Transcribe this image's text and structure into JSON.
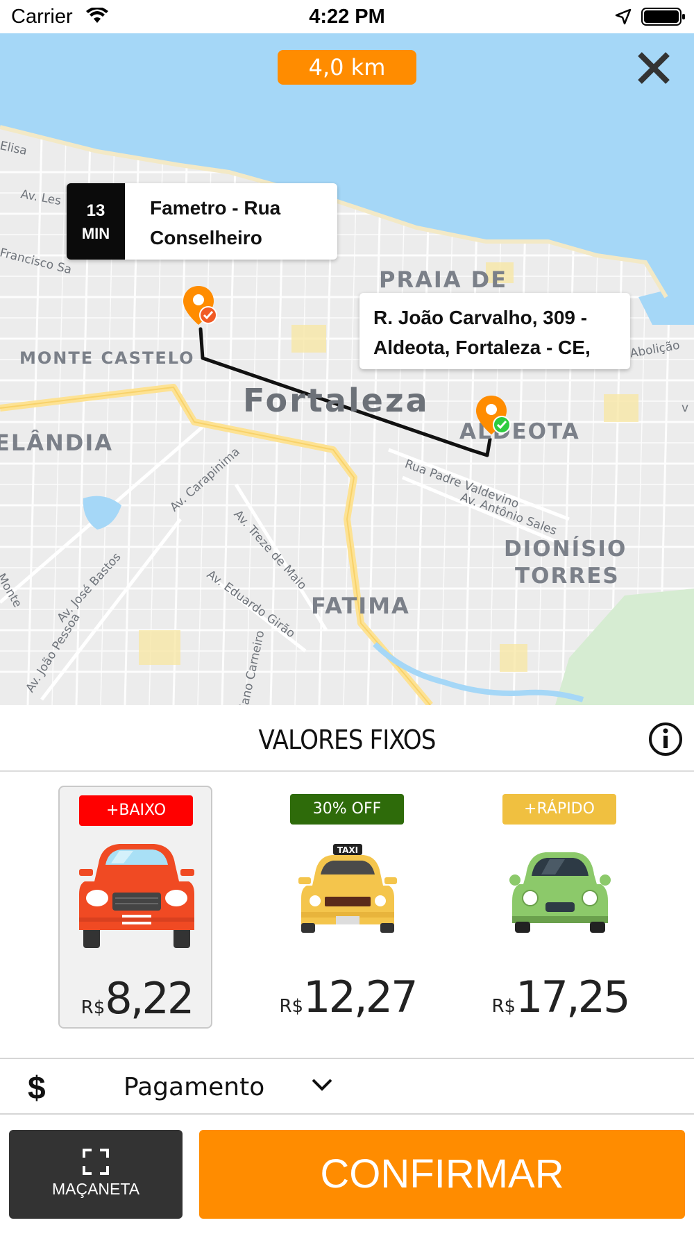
{
  "status_bar": {
    "carrier": "Carrier",
    "time": "4:22 PM",
    "icons": [
      "wifi-icon",
      "location-arrow-icon",
      "battery-icon"
    ]
  },
  "map": {
    "distance": "4,0 km",
    "origin": {
      "eta_value": "13",
      "eta_unit": "MIN",
      "address": "Fametro - Rua Conselheiro"
    },
    "destination": {
      "address": "R. João Carvalho, 309 - Aldeota, Fortaleza - CE,"
    },
    "labels": {
      "city": "Fortaleza",
      "praia": "PRAIA DE",
      "monte_castelo": "MONTE CASTELO",
      "aldeota": "ALDEOTA",
      "elandia": "ELÂNDIA",
      "dionisio": "DIONÍSIO",
      "torres": "TORRES",
      "fatima": "FATIMA"
    },
    "streets": {
      "av_les": "Av. Les",
      "francisco": "Francisco Sa",
      "elisa": "Elisa",
      "abolicao": "Abolição",
      "v": "v",
      "padre": "Rua Padre Valdevino",
      "antonio": "Av. Antônio Sales",
      "carapinima": "Av. Carapinima",
      "treze": "Av. Treze de Maio",
      "eduardo": "Av. Eduardo Girão",
      "jose": "Av. José Bastos",
      "joao": "Av. João Pessoa",
      "carneiro": "iano Carneiro",
      "monte": "Monte"
    },
    "colors": {
      "route": "#111111",
      "pin": "#ff8c00",
      "water": "#a5d7f7",
      "major_road": "#fde293"
    }
  },
  "title": "VALORES FIXOS",
  "vehicles": [
    {
      "badge": "+BAIXO",
      "badge_color": "#ff0000",
      "currency": "R$",
      "price": "8,22",
      "selected": true,
      "icon": "red-car-icon"
    },
    {
      "badge": "30% OFF",
      "badge_color": "#2e6b0a",
      "currency": "R$",
      "price": "12,27",
      "selected": false,
      "icon": "taxi-car-icon"
    },
    {
      "badge": "+RÁPIDO",
      "badge_color": "#f0c040",
      "currency": "R$",
      "price": "17,25",
      "selected": false,
      "icon": "green-car-icon"
    }
  ],
  "payment": {
    "icon_glyph": "$",
    "label": "Pagamento"
  },
  "actions": {
    "handle_label": "MAÇANETA",
    "confirm_label": "CONFIRMAR"
  },
  "accent_color": "#ff8c00"
}
